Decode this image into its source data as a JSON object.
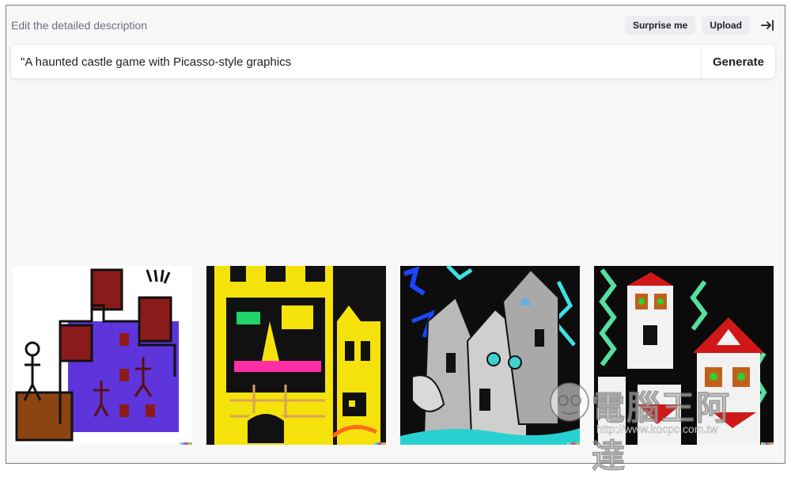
{
  "header": {
    "hint": "Edit the detailed description",
    "surprise_label": "Surprise me",
    "upload_label": "Upload"
  },
  "prompt": {
    "value": "\"A haunted castle game with Picasso-style graphics",
    "generate_label": "Generate"
  },
  "results": [
    {
      "alt": "Childlike drawing of a purple haunted castle with stick figures"
    },
    {
      "alt": "Yellow and black blocky castle with a face"
    },
    {
      "alt": "Grey cubist castle towers on black background"
    },
    {
      "alt": "White castle towers with red roofs and green zigzags"
    }
  ],
  "watermark": {
    "title": "電腦王阿達",
    "url": "http://www.kocpc.com.tw"
  },
  "colors": {
    "background": "#f7f7f8",
    "pill": "#ececf1",
    "text": "#202123",
    "hint": "#6e6e80"
  }
}
